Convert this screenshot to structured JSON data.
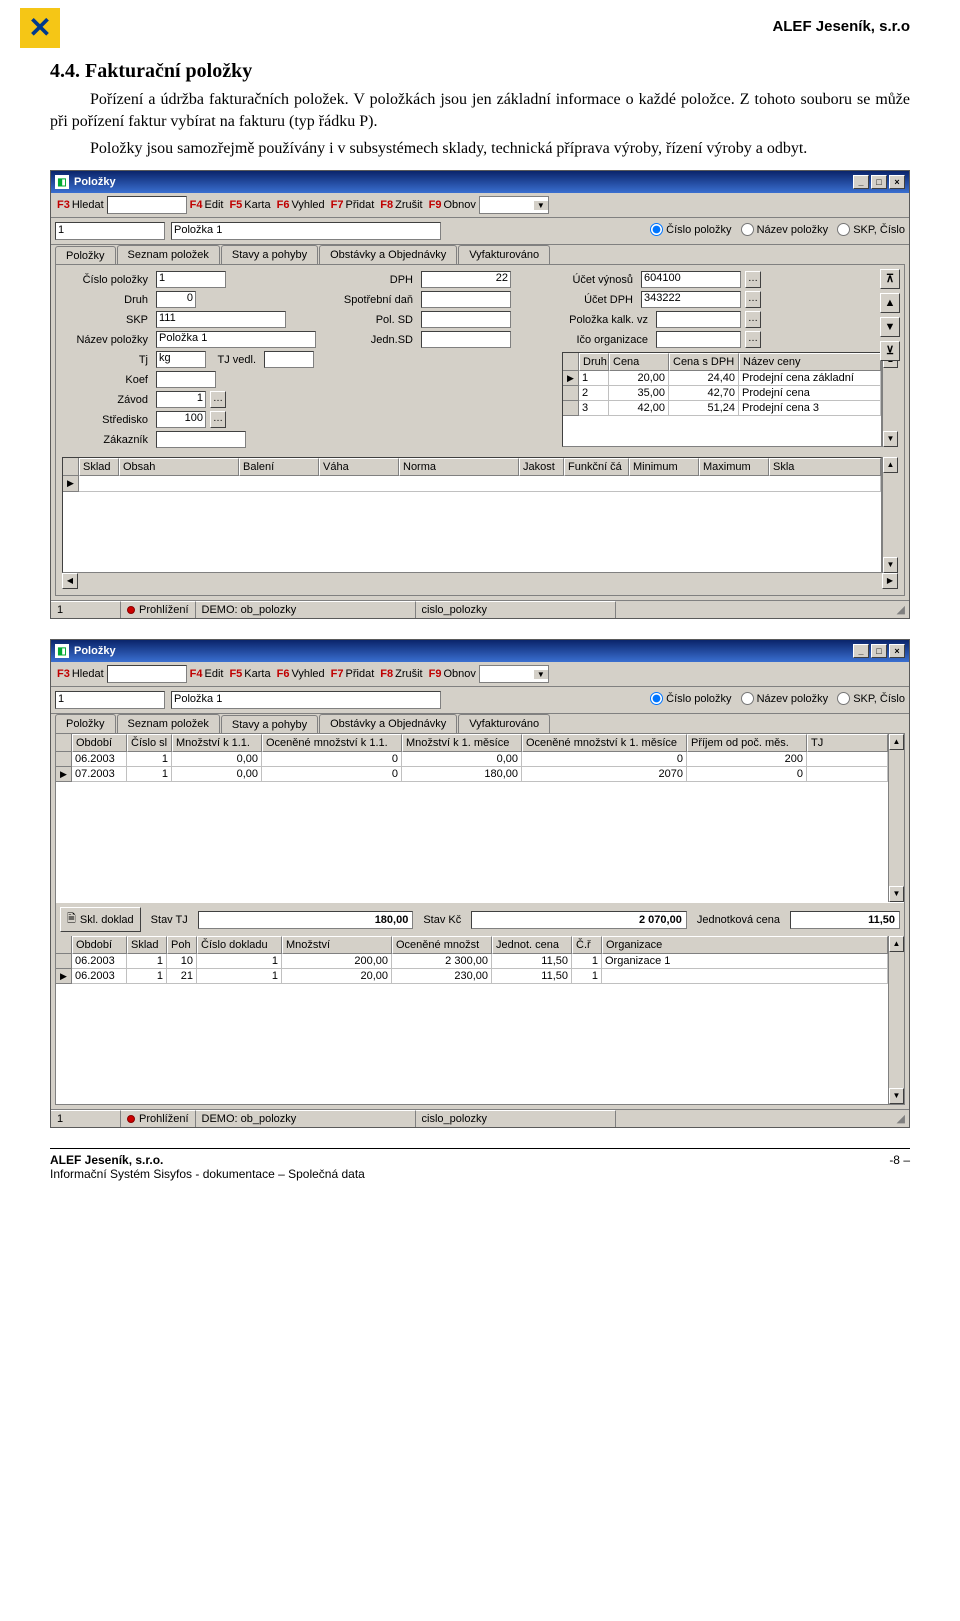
{
  "header": {
    "company": "ALEF Jeseník, s.r.o"
  },
  "section": {
    "num_title": "4.4. Fakturační položky",
    "p1": "Pořízení a údržba fakturačních položek. V položkách jsou jen základní informace o každé položce. Z tohoto souboru se může při pořízení faktur vybírat na fakturu (typ řádku P).",
    "p2": "Položky jsou samozřejmě používány i v subsystémech sklady, technická příprava výroby, řízení výroby a odbyt."
  },
  "win_common": {
    "title": "Položky",
    "btn_min": "_",
    "btn_max": "□",
    "btn_close": "×",
    "toolbar": {
      "f3": "F3",
      "hledat": "Hledat",
      "f4": "F4",
      "edit": "Edit",
      "f5": "F5",
      "karta": "Karta",
      "f6": "F6",
      "vyhled": "Vyhled",
      "f7": "F7",
      "pridat": "Přidat",
      "f8": "F8",
      "zrusit": "Zrušit",
      "f9": "F9",
      "obnov": "Obnov"
    },
    "row2": {
      "field1": "1",
      "field2": "Položka 1",
      "radio1": "Číslo položky",
      "radio2": "Název položky",
      "radio3": "SKP, Číslo"
    },
    "tabs": [
      "Položky",
      "Seznam položek",
      "Stavy a pohyby",
      "Obstávky a Objednávky",
      "Vyfakturováno"
    ],
    "status": {
      "recno": "1",
      "mode": "Prohlížení",
      "source": "DEMO: ob_polozky",
      "key": "cislo_polozky"
    }
  },
  "win1": {
    "form": {
      "cislo_polozky_lbl": "Číslo položky",
      "cislo_polozky": "1",
      "druh_lbl": "Druh",
      "druh": "0",
      "skp_lbl": "SKP",
      "skp": "111",
      "nazev_lbl": "Název položky",
      "nazev": "Položka 1",
      "tj_lbl": "Tj",
      "tj": "kg",
      "tjvedl_lbl": "TJ vedl.",
      "tjvedl": "",
      "koef_lbl": "Koef",
      "koef": "",
      "zavod_lbl": "Závod",
      "zavod": "1",
      "stredisko_lbl": "Středisko",
      "stredisko": "100",
      "zakaznik_lbl": "Zákazník",
      "zakaznik": "",
      "dph_lbl": "DPH",
      "dph": "22",
      "spotrdan_lbl": "Spotřební daň",
      "spotrdan": "",
      "polsd_lbl": "Pol. SD",
      "polsd": "",
      "jednsd_lbl": "Jedn.SD",
      "jednsd": "",
      "ucet_vyn_lbl": "Účet výnosů",
      "ucet_vyn": "604100",
      "ucet_dph_lbl": "Účet DPH",
      "ucet_dph": "343222",
      "kalkvz_lbl": "Položka kalk. vz",
      "kalkvz": "",
      "ico_lbl": "Ičo organizace",
      "ico": ""
    },
    "price_grid": {
      "cols": [
        "Druh",
        "Cena",
        "Cena s DPH",
        "Název ceny"
      ],
      "rows": [
        {
          "druh": "1",
          "cena": "20,00",
          "cenadph": "24,40",
          "nazev": "Prodejní cena základní"
        },
        {
          "druh": "2",
          "cena": "35,00",
          "cenadph": "42,70",
          "nazev": "Prodejní cena"
        },
        {
          "druh": "3",
          "cena": "42,00",
          "cenadph": "51,24",
          "nazev": "Prodejní cena 3"
        }
      ]
    },
    "bottom_grid": {
      "cols": [
        "Sklad",
        "Obsah",
        "Balení",
        "Váha",
        "Norma",
        "Jakost",
        "Funkční čá",
        "Minimum",
        "Maximum",
        "Skla"
      ]
    },
    "nav": {
      "first": "⊼",
      "prev": "▲",
      "next": "▼",
      "last": "⊻"
    }
  },
  "win2": {
    "top_grid": {
      "cols": [
        "Období",
        "Číslo sl",
        "Množství k 1.1.",
        "Oceněné množství k 1.1.",
        "Množství k 1. měsíce",
        "Oceněné množství k 1. měsíce",
        "Příjem od poč. měs.",
        "TJ"
      ],
      "rows": [
        {
          "obd": "06.2003",
          "cs": "1",
          "m11": "0,00",
          "om11": "0",
          "m1m": "0,00",
          "om1m": "0",
          "prij": "200",
          "tj": ""
        },
        {
          "obd": "07.2003",
          "cs": "1",
          "m11": "0,00",
          "om11": "0",
          "m1m": "180,00",
          "om1m": "2070",
          "prij": "0",
          "tj": ""
        }
      ]
    },
    "summary": {
      "skl_doklad": "Skl. doklad",
      "stavtj_lbl": "Stav TJ",
      "stavtj": "180,00",
      "stavkc_lbl": "Stav Kč",
      "stavkc": "2 070,00",
      "jc_lbl": "Jednotková cena",
      "jc": "11,50"
    },
    "bottom_grid": {
      "cols": [
        "Období",
        "Sklad",
        "Poh",
        "Číslo dokladu",
        "Množství",
        "Oceněné množst",
        "Jednot. cena",
        "Č.ř",
        "Organizace"
      ],
      "rows": [
        {
          "obd": "06.2003",
          "skl": "1",
          "poh": "10",
          "cd": "1",
          "mn": "200,00",
          "ocm": "2 300,00",
          "jc": "11,50",
          "cr": "1",
          "org": "Organizace 1"
        },
        {
          "obd": "06.2003",
          "skl": "1",
          "poh": "21",
          "cd": "1",
          "mn": "20,00",
          "ocm": "230,00",
          "jc": "11,50",
          "cr": "1",
          "org": ""
        }
      ]
    }
  },
  "footer": {
    "left1": "ALEF Jeseník, s.r.o.",
    "left2": "Informační Systém Sisyfos - dokumentace – Společná data",
    "right": "-8 –"
  }
}
